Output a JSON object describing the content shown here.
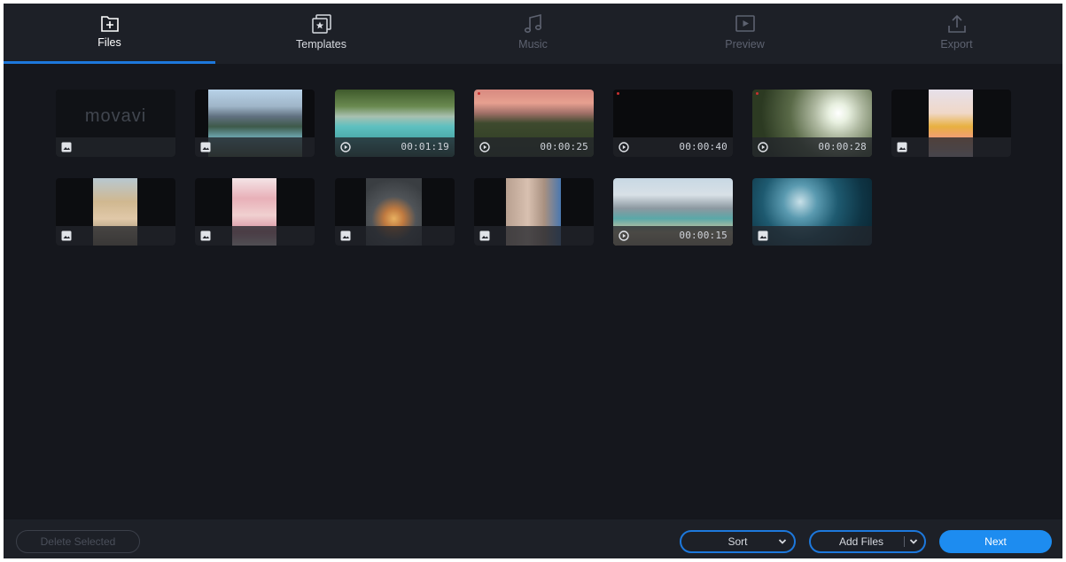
{
  "tabs": [
    {
      "label": "Files",
      "icon": "add-file-icon",
      "state": "active"
    },
    {
      "label": "Templates",
      "icon": "templates-star-icon",
      "state": "normal"
    },
    {
      "label": "Music",
      "icon": "music-note-icon",
      "state": "disabled"
    },
    {
      "label": "Preview",
      "icon": "play-preview-icon",
      "state": "disabled"
    },
    {
      "label": "Export",
      "icon": "export-upload-icon",
      "state": "disabled"
    }
  ],
  "thumbnails": [
    {
      "type": "image",
      "duration": "",
      "logo_text": "movavi"
    },
    {
      "type": "image",
      "duration": ""
    },
    {
      "type": "video",
      "duration": "00:01:19"
    },
    {
      "type": "video",
      "duration": "00:00:25"
    },
    {
      "type": "video",
      "duration": "00:00:40"
    },
    {
      "type": "video",
      "duration": "00:00:28"
    },
    {
      "type": "image",
      "duration": ""
    },
    {
      "type": "image",
      "duration": ""
    },
    {
      "type": "image",
      "duration": ""
    },
    {
      "type": "image",
      "duration": ""
    },
    {
      "type": "image",
      "duration": ""
    },
    {
      "type": "video",
      "duration": "00:00:15"
    },
    {
      "type": "image",
      "duration": ""
    }
  ],
  "footer": {
    "delete_label": "Delete Selected",
    "sort_label": "Sort",
    "add_files_label": "Add Files",
    "next_label": "Next"
  },
  "colors": {
    "accent": "#1d78dc",
    "background": "#15171d",
    "panel": "#1d2027"
  }
}
